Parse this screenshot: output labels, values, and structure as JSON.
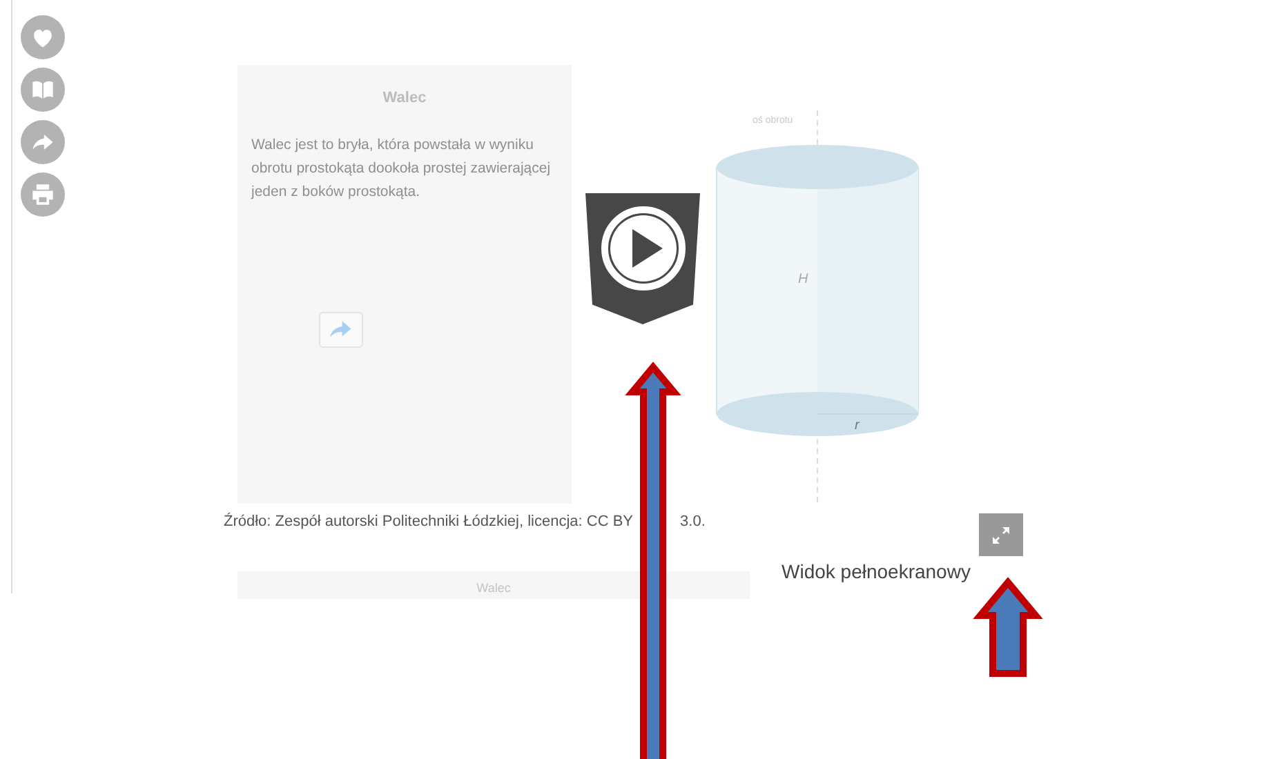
{
  "card": {
    "title": "Walec",
    "body": "Walec jest to bryła, która powstała w wyniku obrotu prostokąta dookoła prostej zawierającej jeden z boków prostokąta."
  },
  "source": {
    "before": "Źródło: Zespół autorski Politechniki Łódzkiej, licencja: CC BY",
    "after": "3.0."
  },
  "second_card": {
    "title": "Walec"
  },
  "figure": {
    "axis_label": "oś obrotu",
    "height_label": "H",
    "radius_label": "r"
  },
  "fullscreen": {
    "caption": "Widok pełnoekranowy"
  }
}
